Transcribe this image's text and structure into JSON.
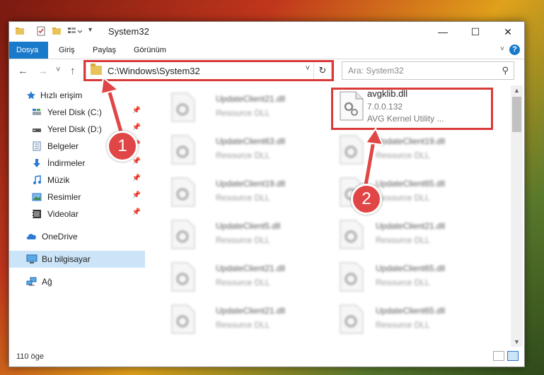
{
  "window": {
    "title": "System32",
    "minimize": "—",
    "maximize": "☐",
    "close": "✕"
  },
  "ribbon": {
    "tabs": [
      {
        "label": "Dosya",
        "active": true
      },
      {
        "label": "Giriş",
        "active": false
      },
      {
        "label": "Paylaş",
        "active": false
      },
      {
        "label": "Görünüm",
        "active": false
      }
    ],
    "help": "?"
  },
  "nav": {
    "back": "←",
    "forward": "→",
    "recent": "˅",
    "up": "↑",
    "address": "C:\\Windows\\System32",
    "refresh": "↻",
    "search_placeholder": "Ara: System32"
  },
  "sidebar": {
    "items": [
      {
        "label": "Hızlı erişim",
        "icon": "star-icon",
        "pinned": false
      },
      {
        "label": "Yerel Disk (C:)",
        "icon": "drive-icon",
        "pinned": true
      },
      {
        "label": "Yerel Disk (D:)",
        "icon": "drive-icon",
        "pinned": true
      },
      {
        "label": "Belgeler",
        "icon": "documents-icon",
        "pinned": true
      },
      {
        "label": "İndirmeler",
        "icon": "download-icon",
        "pinned": true
      },
      {
        "label": "Müzik",
        "icon": "music-icon",
        "pinned": true
      },
      {
        "label": "Resimler",
        "icon": "pictures-icon",
        "pinned": true
      },
      {
        "label": "Videolar",
        "icon": "videos-icon",
        "pinned": true
      },
      {
        "label": "OneDrive",
        "icon": "cloud-icon",
        "pinned": false
      },
      {
        "label": "Bu bilgisayar",
        "icon": "computer-icon",
        "pinned": false,
        "selected": true
      },
      {
        "label": "Ağ",
        "icon": "network-icon",
        "pinned": false
      }
    ]
  },
  "files": {
    "highlighted": {
      "name": "avgklib.dll",
      "version": "7.0.0.132",
      "description": "AVG Kernel Utility ..."
    },
    "left_column": [
      {
        "name": "UpdateClient21.dll",
        "desc": "Resource DLL"
      },
      {
        "name": "UpdateClient63.dll",
        "desc": "Resource DLL"
      },
      {
        "name": "UpdateClient19.dll",
        "desc": "Resource DLL"
      },
      {
        "name": "UpdateClient5.dll",
        "desc": "Resource DLL"
      },
      {
        "name": "UpdateClient21.dll",
        "desc": "Resource DLL"
      },
      {
        "name": "UpdateClient21.dll",
        "desc": "Resource DLL"
      }
    ],
    "right_column": [
      {
        "name": "UpdateClient19.dll",
        "desc": "Resource DLL"
      },
      {
        "name": "UpdateClient65.dll",
        "desc": "Resource DLL"
      },
      {
        "name": "UpdateClient21.dll",
        "desc": "Resource DLL"
      },
      {
        "name": "UpdateClient65.dll",
        "desc": "Resource DLL"
      },
      {
        "name": "UpdateClient65.dll",
        "desc": "Resource DLL"
      }
    ]
  },
  "status": {
    "count": "110 öge"
  },
  "markers": {
    "step1": "1",
    "step2": "2"
  },
  "colors": {
    "accent": "#1979ca",
    "highlight_red": "#d93a3a",
    "marker_red": "#e04646",
    "selected_bg": "#cce4f7"
  }
}
